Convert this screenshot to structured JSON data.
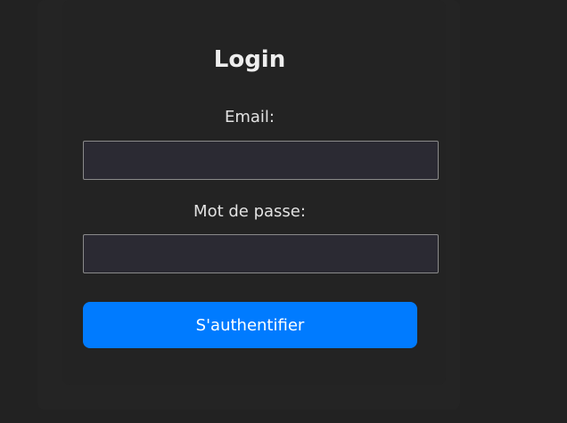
{
  "login_form": {
    "title": "Login",
    "email_label": "Email:",
    "email_value": "",
    "email_placeholder": "",
    "password_label": "Mot de passe:",
    "password_value": "",
    "password_placeholder": "",
    "submit_label": "S'authentifier"
  },
  "colors": {
    "background": "#222222",
    "input_background": "#2b2a33",
    "input_border": "#8a8a8a",
    "button_accent": "#007bff",
    "text": "#e8e8e8"
  }
}
